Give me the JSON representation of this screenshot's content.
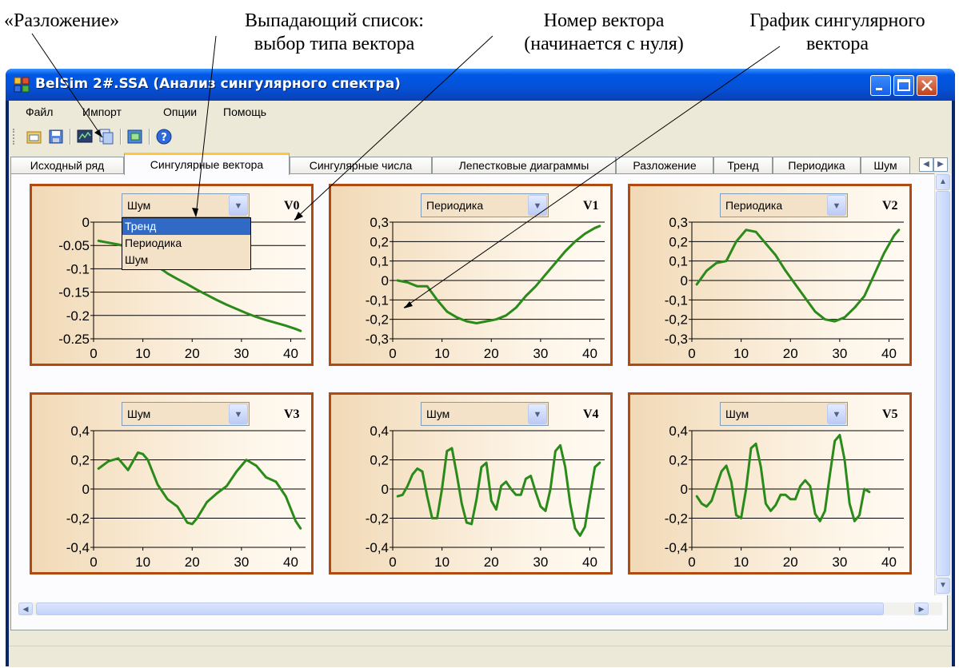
{
  "annotations": {
    "razlozhenie": "«Разложение»",
    "dropdown_line1": "Выпадающий список:",
    "dropdown_line2": "выбор типа вектора",
    "vector_number_line1": "Номер вектора",
    "vector_number_line2": "(начинается с нуля)",
    "graph_line1": "График сингулярного",
    "graph_line2": "вектора"
  },
  "window": {
    "title": "BelSim 2#.SSA (Анализ сингулярного спектра)",
    "title_bar_color": "#0451d6",
    "close_button_color": "#c0401c"
  },
  "menu": {
    "items": [
      "Файл",
      "Импорт",
      "Опции",
      "Помощь"
    ]
  },
  "toolbar": {
    "icons": [
      "open-icon",
      "save-icon",
      "decomposition-icon",
      "copy-icon",
      "export-icon",
      "help-icon"
    ]
  },
  "tabs": {
    "items": [
      "Исходный ряд",
      "Сингулярные вектора",
      "Сингулярные числа",
      "Лепестковые диаграммы",
      "Разложение",
      "Тренд",
      "Периодика",
      "Шум"
    ],
    "active": "Сингулярные вектора"
  },
  "panels": [
    {
      "id": "V0",
      "type_value": "Шум"
    },
    {
      "id": "V1",
      "type_value": "Периодика"
    },
    {
      "id": "V2",
      "type_value": "Периодика"
    },
    {
      "id": "V3",
      "type_value": "Шум"
    },
    {
      "id": "V4",
      "type_value": "Шум"
    },
    {
      "id": "V5",
      "type_value": "Шум"
    }
  ],
  "dropdown_options": [
    "Тренд",
    "Периодика",
    "Шум"
  ],
  "dropdown_selected": "Тренд",
  "colors": {
    "panel_border": "#b04a11",
    "series": "#2a8a1a",
    "selection": "#316ac5"
  },
  "chart_data": [
    {
      "type": "line",
      "title": "V0",
      "xlim": [
        0,
        43
      ],
      "ylim": [
        -0.25,
        0
      ],
      "xticks": [
        0,
        10,
        20,
        30,
        40
      ],
      "yticks": [
        "0",
        "-0.05",
        "-0.1",
        "-0.15",
        "-0.2",
        "-0.25"
      ],
      "ytick_values": [
        0,
        -0.05,
        -0.1,
        -0.15,
        -0.2,
        -0.25
      ],
      "x": [
        1,
        3,
        5,
        7,
        9,
        11,
        13,
        15,
        17,
        19,
        21,
        23,
        25,
        27,
        29,
        31,
        33,
        35,
        37,
        39,
        41,
        42
      ],
      "y": [
        -0.04,
        -0.044,
        -0.048,
        -0.053,
        -0.066,
        -0.08,
        -0.095,
        -0.11,
        -0.122,
        -0.133,
        -0.145,
        -0.156,
        -0.167,
        -0.177,
        -0.186,
        -0.195,
        -0.203,
        -0.21,
        -0.216,
        -0.222,
        -0.229,
        -0.233
      ]
    },
    {
      "type": "line",
      "title": "V1",
      "xlim": [
        0,
        43
      ],
      "ylim": [
        -0.3,
        0.3
      ],
      "xticks": [
        0,
        10,
        20,
        30,
        40
      ],
      "yticks": [
        "0,3",
        "0,2",
        "0,1",
        "0",
        "-0,1",
        "-0,2",
        "-0,3"
      ],
      "ytick_values": [
        0.3,
        0.2,
        0.1,
        0,
        -0.1,
        -0.2,
        -0.3
      ],
      "x": [
        1,
        3,
        5,
        7,
        9,
        11,
        13,
        15,
        17,
        19,
        21,
        23,
        25,
        27,
        29,
        31,
        33,
        35,
        37,
        39,
        41,
        42
      ],
      "y": [
        0,
        -0.01,
        -0.03,
        -0.03,
        -0.1,
        -0.16,
        -0.19,
        -0.21,
        -0.22,
        -0.21,
        -0.2,
        -0.18,
        -0.14,
        -0.08,
        -0.03,
        0.03,
        0.09,
        0.15,
        0.2,
        0.24,
        0.27,
        0.28
      ]
    },
    {
      "type": "line",
      "title": "V2",
      "xlim": [
        0,
        43
      ],
      "ylim": [
        -0.3,
        0.3
      ],
      "xticks": [
        0,
        10,
        20,
        30,
        40
      ],
      "yticks": [
        "0,3",
        "0,2",
        "0,1",
        "0",
        "-0,1",
        "-0,2",
        "-0,3"
      ],
      "ytick_values": [
        0.3,
        0.2,
        0.1,
        0,
        -0.1,
        -0.2,
        -0.3
      ],
      "x": [
        1,
        3,
        5,
        7,
        9,
        11,
        13,
        15,
        17,
        19,
        21,
        23,
        25,
        27,
        29,
        31,
        33,
        35,
        37,
        39,
        41,
        42
      ],
      "y": [
        -0.02,
        0.05,
        0.09,
        0.1,
        0.2,
        0.26,
        0.25,
        0.19,
        0.13,
        0.05,
        -0.02,
        -0.09,
        -0.16,
        -0.2,
        -0.21,
        -0.19,
        -0.14,
        -0.08,
        0.03,
        0.14,
        0.23,
        0.26
      ]
    },
    {
      "type": "line",
      "title": "V3",
      "xlim": [
        0,
        43
      ],
      "ylim": [
        -0.4,
        0.4
      ],
      "xticks": [
        0,
        10,
        20,
        30,
        40
      ],
      "yticks": [
        "0,4",
        "0,2",
        "0",
        "-0,2",
        "-0,4"
      ],
      "ytick_values": [
        0.4,
        0.2,
        0,
        -0.2,
        -0.4
      ],
      "x": [
        1,
        3,
        5,
        7,
        9,
        10,
        11,
        13,
        15,
        17,
        19,
        20,
        21,
        23,
        25,
        27,
        29,
        31,
        33,
        35,
        37,
        39,
        41,
        42
      ],
      "y": [
        0.14,
        0.19,
        0.21,
        0.13,
        0.25,
        0.24,
        0.2,
        0.03,
        -0.07,
        -0.12,
        -0.23,
        -0.24,
        -0.2,
        -0.09,
        -0.03,
        0.02,
        0.12,
        0.2,
        0.16,
        0.08,
        0.05,
        -0.05,
        -0.22,
        -0.27
      ]
    },
    {
      "type": "line",
      "title": "V4",
      "xlim": [
        0,
        43
      ],
      "ylim": [
        -0.4,
        0.4
      ],
      "xticks": [
        0,
        10,
        20,
        30,
        40
      ],
      "yticks": [
        "0,4",
        "0,2",
        "0",
        "-0,2",
        "-0,4"
      ],
      "ytick_values": [
        0.4,
        0.2,
        0,
        -0.2,
        -0.4
      ],
      "x": [
        1,
        2,
        3,
        4,
        5,
        6,
        7,
        8,
        9,
        10,
        11,
        12,
        13,
        14,
        15,
        16,
        17,
        18,
        19,
        20,
        21,
        22,
        23,
        24,
        25,
        26,
        27,
        28,
        29,
        30,
        31,
        32,
        33,
        34,
        35,
        36,
        37,
        38,
        39,
        40,
        41,
        42
      ],
      "y": [
        -0.05,
        -0.04,
        0.02,
        0.1,
        0.14,
        0.12,
        -0.05,
        -0.2,
        -0.2,
        0.0,
        0.26,
        0.28,
        0.1,
        -0.1,
        -0.23,
        -0.24,
        -0.07,
        0.15,
        0.18,
        -0.08,
        -0.14,
        0.02,
        0.05,
        0.0,
        -0.04,
        -0.04,
        0.07,
        0.09,
        -0.02,
        -0.12,
        -0.15,
        0.0,
        0.26,
        0.3,
        0.15,
        -0.1,
        -0.27,
        -0.32,
        -0.26,
        -0.05,
        0.15,
        0.18
      ]
    },
    {
      "type": "line",
      "title": "V5",
      "xlim": [
        0,
        43
      ],
      "ylim": [
        -0.4,
        0.4
      ],
      "xticks": [
        0,
        10,
        20,
        30,
        40
      ],
      "yticks": [
        "0,4",
        "0,2",
        "0",
        "-0,2",
        "-0,4"
      ],
      "ytick_values": [
        0.4,
        0.2,
        0,
        -0.2,
        -0.4
      ],
      "x": [
        1,
        2,
        3,
        4,
        5,
        6,
        7,
        8,
        9,
        10,
        11,
        12,
        13,
        14,
        15,
        16,
        17,
        18,
        19,
        20,
        21,
        22,
        23,
        24,
        25,
        26,
        27,
        28,
        29,
        30,
        31,
        32,
        33,
        34,
        35,
        36,
        37,
        38,
        39,
        40,
        41,
        42
      ],
      "y": [
        -0.05,
        -0.1,
        -0.12,
        -0.08,
        0.02,
        0.12,
        0.16,
        0.05,
        -0.18,
        -0.2,
        0.0,
        0.28,
        0.31,
        0.15,
        -0.1,
        -0.15,
        -0.11,
        -0.04,
        -0.04,
        -0.07,
        -0.07,
        0.02,
        0.06,
        0.02,
        -0.17,
        -0.22,
        -0.15,
        0.1,
        0.33,
        0.37,
        0.2,
        -0.1,
        -0.22,
        -0.18,
        0.0,
        -0.02
      ]
    }
  ]
}
